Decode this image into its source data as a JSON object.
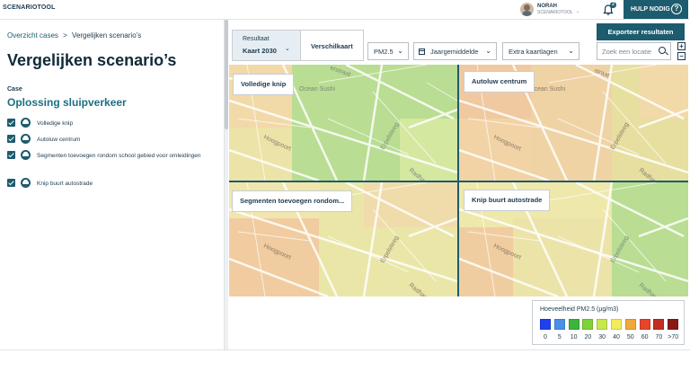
{
  "app": {
    "name": "SCENARIOTOOL"
  },
  "user": {
    "name": "NORAH",
    "subtitle": "SCENARIOTOOL",
    "caret": "⌄"
  },
  "notifications": {
    "count": "2"
  },
  "help": {
    "label": "HULP NODIG",
    "icon": "?"
  },
  "breadcrumb": {
    "link": "Overzicht cases",
    "separator": ">",
    "current": "Vergelijken scenario’s"
  },
  "page": {
    "title": "Vergelijken scenario’s"
  },
  "case": {
    "label": "Case",
    "title": "Oplossing sluipverkeer",
    "scenarios": [
      {
        "label": "Volledige knip",
        "checked": true,
        "icon": "car-icon"
      },
      {
        "label": "Autoluw centrum",
        "checked": true,
        "icon": "car-icon"
      },
      {
        "label": "Segmenten toevoegen rondom school gebied voor omleidingen",
        "checked": true,
        "icon": "car-icon"
      },
      {
        "label": "Knip buurt autostrade",
        "checked": true,
        "icon": "car-icon"
      }
    ]
  },
  "toolbar": {
    "result_sub": "Resultaat",
    "result_value": "Kaart 2030",
    "result_caret": "⌄",
    "diff_label": "Verschilkaart",
    "pollutant": "PM2.5",
    "period": "Jaargemiddelde",
    "layers": "Extra kaartlagen",
    "caret": "⌄",
    "export_label": "Exporteer resultaten",
    "search_placeholder": "Zoek een locatie",
    "zoom_in": "+",
    "zoom_out": "−"
  },
  "map": {
    "tiles": [
      {
        "title": "Volledige knip"
      },
      {
        "title": "Autoluw centrum"
      },
      {
        "title": "Segmenten toevoegen rondom..."
      },
      {
        "title": "Knip buurt autostrade"
      }
    ],
    "streets": {
      "ocean": "Ocean Sushi",
      "hoogpoort": "Hoogpoort",
      "erpelsteeg": "Erpelsteeg",
      "straat": "straat",
      "radham": "Radham",
      "erstraat": "erstraat"
    }
  },
  "legend": {
    "title": "Hoeveelheid PM2.5 (µg/m3)",
    "items": [
      {
        "label": "0",
        "color": "#1f3ff0"
      },
      {
        "label": "5",
        "color": "#4a90e8"
      },
      {
        "label": "10",
        "color": "#3cb43c"
      },
      {
        "label": "20",
        "color": "#7fd23a"
      },
      {
        "label": "30",
        "color": "#c6e84a"
      },
      {
        "label": "40",
        "color": "#f2ec5a"
      },
      {
        "label": "50",
        "color": "#f0a838"
      },
      {
        "label": "60",
        "color": "#e8452a"
      },
      {
        "label": "70",
        "color": "#c42d22"
      },
      {
        "label": ">70",
        "color": "#8a1a14"
      }
    ]
  }
}
